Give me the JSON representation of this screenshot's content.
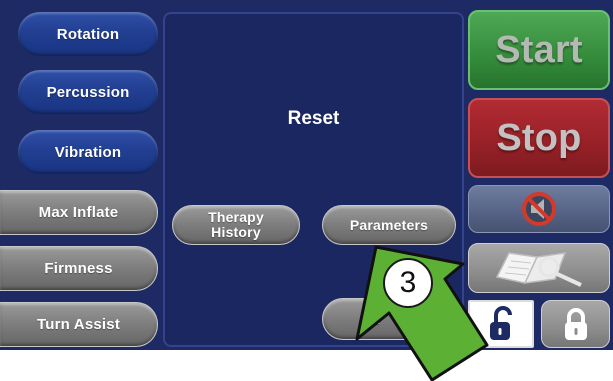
{
  "mode_buttons": {
    "rotation": "Rotation",
    "percussion": "Percussion",
    "vibration": "Vibration"
  },
  "function_buttons": {
    "max_inflate": "Max Inflate",
    "firmness": "Firmness",
    "turn_assist": "Turn Assist"
  },
  "reset_panel": {
    "title": "Reset",
    "therapy_history": "Therapy History",
    "parameters": "Parameters",
    "cancel_partial": "Ca"
  },
  "control_buttons": {
    "start": "Start",
    "stop": "Stop",
    "silence_icon": "speaker-muted-icon",
    "manual_icon": "manual-book-icon",
    "unlock_icon": "unlocked-padlock-icon",
    "lock_icon": "locked-padlock-icon"
  },
  "callout": {
    "step_number": "3",
    "arrow_color": "#5cb134"
  },
  "colors": {
    "screen_background": "#1d2a63",
    "start_green": "#348c3b",
    "stop_red": "#962027"
  }
}
